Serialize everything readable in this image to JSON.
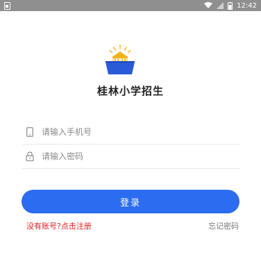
{
  "status_bar": {
    "time": "12:42",
    "icons": [
      "sim-icon",
      "wifi-icon",
      "signal-icon",
      "battery-icon"
    ]
  },
  "app": {
    "title": "桂林小学招生",
    "logo": "school-building-logo"
  },
  "form": {
    "phone_placeholder": "请输入手机号",
    "phone_value": "",
    "password_placeholder": "请输入密码",
    "password_value": "",
    "login_label": "登录"
  },
  "links": {
    "register_label": "没有账号?点击注册",
    "forgot_label": "忘记密码"
  },
  "colors": {
    "primary": "#2c6cf0",
    "register_link": "#e02020",
    "logo_blue": "#2a5ad8",
    "logo_gold": "#f2b21c",
    "status_bar": "#8f8f8f"
  }
}
